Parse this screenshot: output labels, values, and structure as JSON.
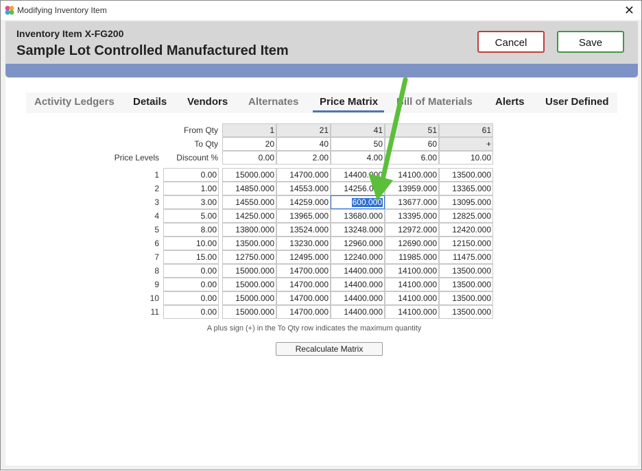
{
  "window": {
    "title": "Modifying Inventory Item",
    "close_glyph": "✕"
  },
  "header": {
    "item_id": "Inventory Item X-FG200",
    "item_name": "Sample Lot Controlled Manufactured Item",
    "cancel_label": "Cancel",
    "save_label": "Save",
    "cancel_color": "#c23b3b",
    "save_color": "#3d9a3d",
    "accent_bar_color": "#7d93c6"
  },
  "tabs": [
    {
      "label": "Activity Ledgers",
      "active": false
    },
    {
      "label": "Details",
      "active": false
    },
    {
      "label": "Vendors",
      "active": false
    },
    {
      "label": "Alternates",
      "active": false
    },
    {
      "label": "Price Matrix",
      "active": true
    },
    {
      "label": "Bill of Materials",
      "active": false
    },
    {
      "label": "Alerts",
      "active": false
    },
    {
      "label": "User Defined",
      "active": false
    }
  ],
  "matrix": {
    "from_qty_label": "From Qty",
    "to_qty_label": "To Qty",
    "price_levels_label": "Price Levels",
    "discount_label": "Discount %",
    "from_qty": [
      "1",
      "21",
      "41",
      "51",
      "61"
    ],
    "to_qty": [
      "20",
      "40",
      "50",
      "60",
      "+"
    ],
    "discounts": [
      "0.00",
      "2.00",
      "4.00",
      "6.00",
      "10.00"
    ],
    "rows": [
      {
        "level": "1",
        "discount": "0.00",
        "prices": [
          "15000.000",
          "14700.000",
          "14400.000",
          "14100.000",
          "13500.000"
        ]
      },
      {
        "level": "2",
        "discount": "1.00",
        "prices": [
          "14850.000",
          "14553.000",
          "14256.000",
          "13959.000",
          "13365.000"
        ]
      },
      {
        "level": "3",
        "discount": "3.00",
        "prices": [
          "14550.000",
          "14259.000",
          "600.000",
          "13677.000",
          "13095.000"
        ]
      },
      {
        "level": "4",
        "discount": "5.00",
        "prices": [
          "14250.000",
          "13965.000",
          "13680.000",
          "13395.000",
          "12825.000"
        ]
      },
      {
        "level": "5",
        "discount": "8.00",
        "prices": [
          "13800.000",
          "13524.000",
          "13248.000",
          "12972.000",
          "12420.000"
        ]
      },
      {
        "level": "6",
        "discount": "10.00",
        "prices": [
          "13500.000",
          "13230.000",
          "12960.000",
          "12690.000",
          "12150.000"
        ]
      },
      {
        "level": "7",
        "discount": "15.00",
        "prices": [
          "12750.000",
          "12495.000",
          "12240.000",
          "11985.000",
          "11475.000"
        ]
      },
      {
        "level": "8",
        "discount": "0.00",
        "prices": [
          "15000.000",
          "14700.000",
          "14400.000",
          "14100.000",
          "13500.000"
        ]
      },
      {
        "level": "9",
        "discount": "0.00",
        "prices": [
          "15000.000",
          "14700.000",
          "14400.000",
          "14100.000",
          "13500.000"
        ]
      },
      {
        "level": "10",
        "discount": "0.00",
        "prices": [
          "15000.000",
          "14700.000",
          "14400.000",
          "14100.000",
          "13500.000"
        ]
      },
      {
        "level": "11",
        "discount": "0.00",
        "prices": [
          "15000.000",
          "14700.000",
          "14400.000",
          "14100.000",
          "13500.000"
        ]
      }
    ],
    "note": "A plus sign (+) in the To Qty row indicates the maximum quantity",
    "recalc_label": "Recalculate Matrix",
    "arrow_color": "#5bbf3a"
  }
}
